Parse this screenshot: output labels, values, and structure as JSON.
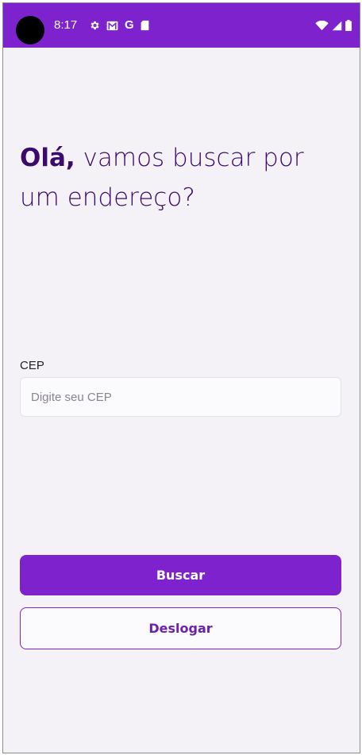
{
  "status_bar": {
    "time": "8:17",
    "google_letter": "G",
    "left_icons": [
      "settings-icon",
      "gmail-icon",
      "google-icon",
      "sd-card-icon"
    ],
    "right_icons": [
      "wifi-icon",
      "cell-signal-icon",
      "battery-icon"
    ],
    "background_color": "#7e22ce"
  },
  "greeting": {
    "bold": "Olá,",
    "rest": " vamos buscar por um endereço?"
  },
  "form": {
    "cep_label": "CEP",
    "cep_placeholder": "Digite seu CEP",
    "cep_value": ""
  },
  "actions": {
    "search_label": "Buscar",
    "logout_label": "Deslogar"
  },
  "colors": {
    "accent": "#7e22ce",
    "heading": "#3b0a6b",
    "background": "#f4f2f6"
  }
}
